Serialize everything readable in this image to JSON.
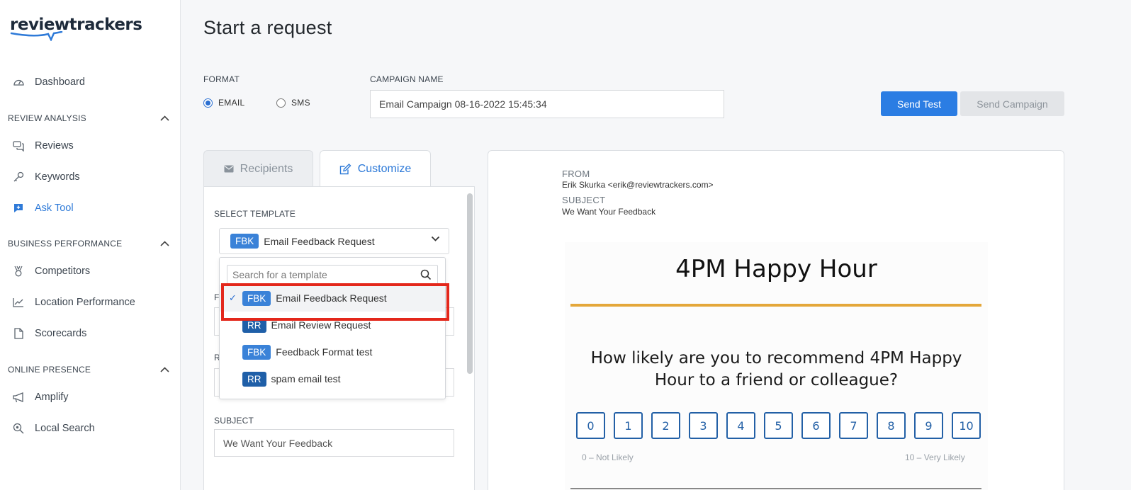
{
  "logo": {
    "text": "reviewtrackers"
  },
  "sidebar": {
    "dashboard": "Dashboard",
    "sections": {
      "review_analysis": "REVIEW ANALYSIS",
      "business_performance": "BUSINESS PERFORMANCE",
      "online_presence": "ONLINE PRESENCE"
    },
    "items": {
      "reviews": "Reviews",
      "keywords": "Keywords",
      "ask_tool": "Ask Tool",
      "competitors": "Competitors",
      "location_performance": "Location Performance",
      "scorecards": "Scorecards",
      "amplify": "Amplify",
      "local_search": "Local Search"
    },
    "active_item": "Ask Tool"
  },
  "page": {
    "title": "Start a request"
  },
  "format": {
    "label": "FORMAT",
    "options": [
      "EMAIL",
      "SMS"
    ],
    "selected": "EMAIL"
  },
  "campaign": {
    "label": "CAMPAIGN NAME",
    "value": "Email Campaign 08-16-2022 15:45:34"
  },
  "buttons": {
    "send_test": "Send Test",
    "send_campaign": "Send Campaign"
  },
  "tabs": {
    "recipients": "Recipients",
    "customize": "Customize",
    "active": "Customize"
  },
  "template": {
    "label": "SELECT TEMPLATE",
    "selected_badge": "FBK",
    "selected_name": "Email Feedback Request",
    "search_placeholder": "Search for a template",
    "options": [
      {
        "badge": "FBK",
        "name": "Email Feedback Request",
        "selected": true
      },
      {
        "badge": "RR",
        "name": "Email Review Request",
        "selected": false
      },
      {
        "badge": "FBK",
        "name": "Feedback Format test",
        "selected": false
      },
      {
        "badge": "RR",
        "name": "spam email test",
        "selected": false
      }
    ],
    "hidden_labels": [
      "F",
      "R"
    ]
  },
  "subject": {
    "label": "SUBJECT",
    "value": "We Want Your Feedback"
  },
  "preview": {
    "from_label": "FROM",
    "from_value": "Erik Skurka <erik@reviewtrackers.com>",
    "subject_label": "SUBJECT",
    "subject_value": "We Want Your Feedback",
    "title": "4PM Happy Hour",
    "question_line1": "How likely are you to recommend 4PM Happy",
    "question_line2": "Hour to a friend or colleague?",
    "scale": [
      "0",
      "1",
      "2",
      "3",
      "4",
      "5",
      "6",
      "7",
      "8",
      "9",
      "10"
    ],
    "low_label": "0 – Not Likely",
    "high_label": "10 – Very Likely"
  },
  "colors": {
    "accent": "#2b7de3",
    "highlight": "#e3271b",
    "gold": "#e4a73a",
    "scale_blue": "#2360a6"
  }
}
